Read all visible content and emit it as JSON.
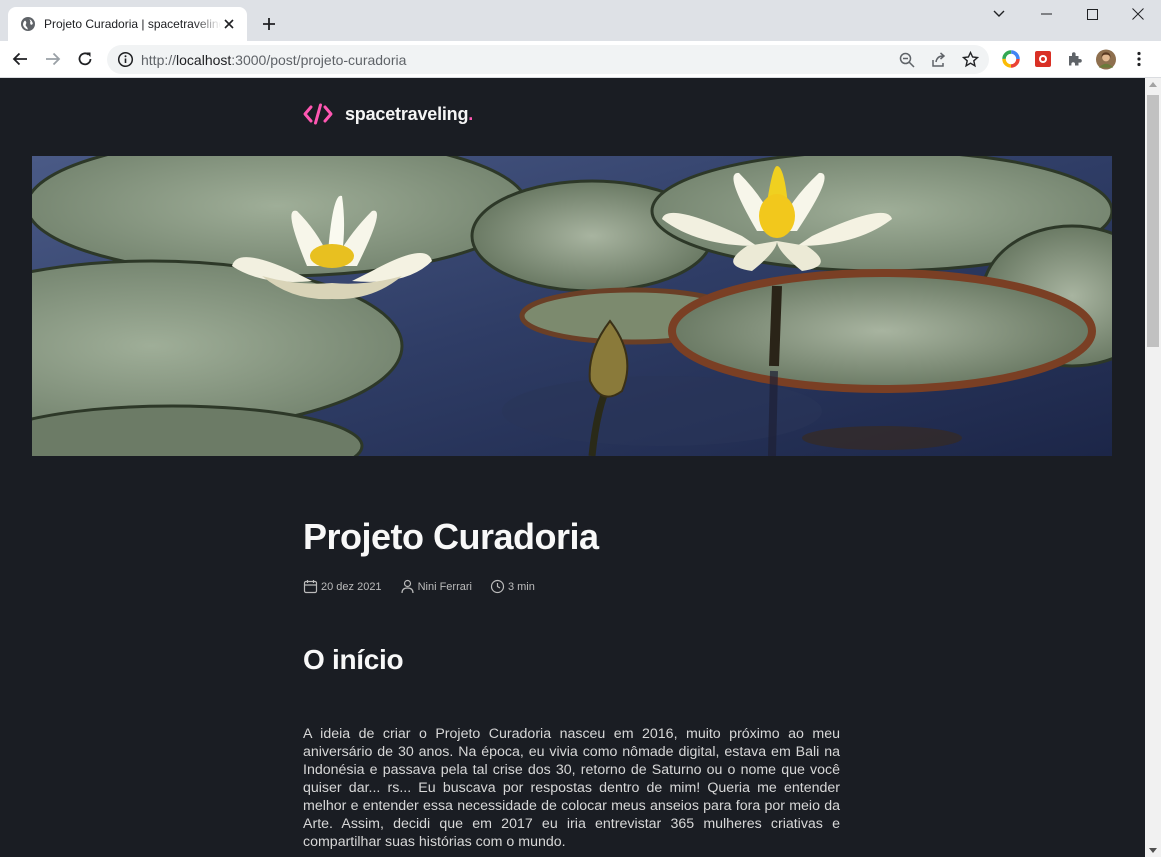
{
  "browser": {
    "tab_title": "Projeto Curadoria | spacetraveling",
    "url_prefix": "http://",
    "url_host": "localhost",
    "url_rest": ":3000/post/projeto-curadoria",
    "icons": [
      "globe-icon",
      "close-icon",
      "plus-icon",
      "back-icon",
      "forward-icon",
      "reload-icon",
      "info-icon",
      "zoom-icon",
      "share-icon",
      "star-icon",
      "extensions-icon",
      "menu-icon"
    ]
  },
  "site": {
    "logo_text": "spacetraveling",
    "logo_dot": ".",
    "accent_color": "#ff57b2",
    "background_color": "#1a1d23"
  },
  "post": {
    "title": "Projeto Curadoria",
    "date": "20 dez 2021",
    "author": "Nini Ferrari",
    "reading_time": "3 min",
    "section_heading": "O início",
    "paragraph": "A ideia de criar o Projeto Curadoria nasceu em 2016, muito próximo ao meu aniversário de 30 anos. Na época, eu vivia como nômade digital, estava em Bali na Indonésia e passava pela tal crise dos 30, retorno de Saturno ou o nome que você quiser dar... rs... Eu buscava por respostas dentro de mim! Queria me entender melhor e entender essa necessidade de colocar meus anseios para fora por meio da Arte. Assim, decidi que em 2017 eu iria entrevistar 365 mulheres criativas e compartilhar suas histórias com o mundo."
  }
}
